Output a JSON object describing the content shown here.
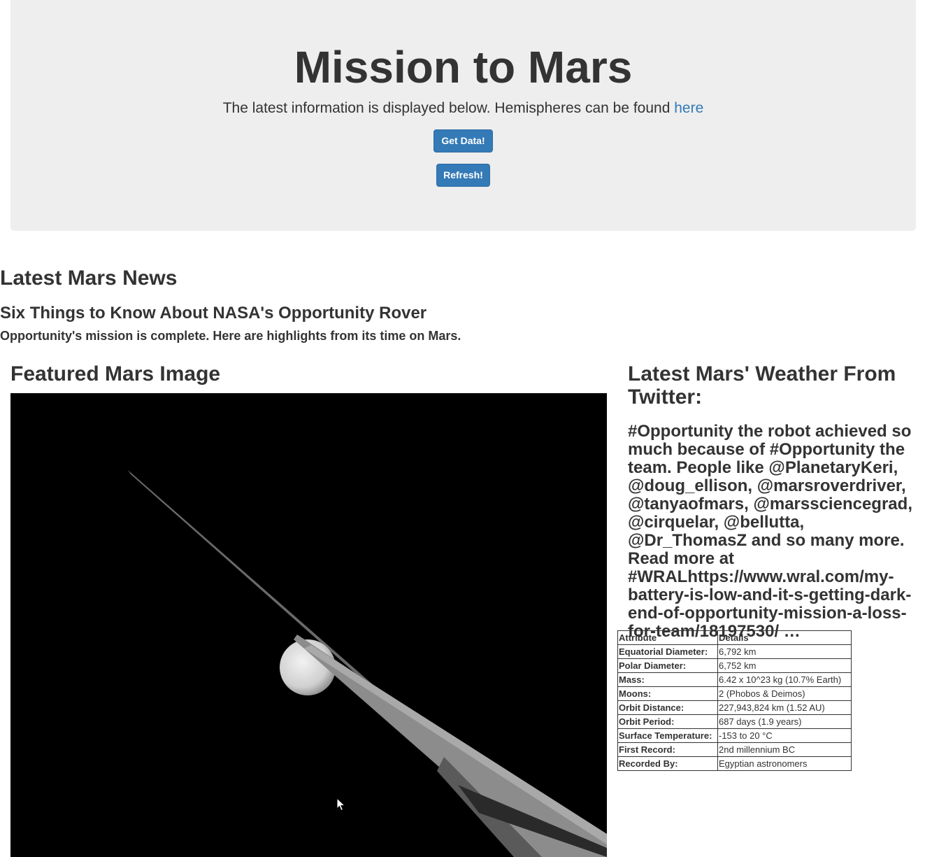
{
  "header": {
    "title": "Mission to Mars",
    "subtitle": "The latest information is displayed below. Hemispheres can be found",
    "hemispheres_link": "here",
    "get_data_label": "Get Data!",
    "refresh_label": "Refresh!"
  },
  "news": {
    "heading": "Latest Mars News",
    "title": "Six Things to Know About NASA's Opportunity Rover",
    "teaser": "Opportunity's mission is complete. Here are highlights from its time on Mars."
  },
  "featured": {
    "heading": "Featured Mars Image"
  },
  "weather": {
    "heading": "Latest Mars' Weather From Twitter:",
    "tweet": "#Opportunity the robot achieved so much because of #Opportunity the team. People like @PlanetaryKeri, @doug_ellison, @marsroverdriver, @tanyaofmars, @marssciencegrad, @cirquelar, @bellutta, @Dr_ThomasZ and so many more. Read more at #WRALhttps://www.wral.com/my-battery-is-low-and-it-s-getting-dark-end-of-opportunity-mission-a-loss-for-team/18197530/ …"
  },
  "facts": {
    "headers": [
      "Attribute",
      "Details"
    ],
    "rows": [
      [
        "Equatorial Diameter:",
        "6,792 km"
      ],
      [
        "Polar Diameter:",
        "6,752 km"
      ],
      [
        "Mass:",
        "6.42 x 10^23 kg (10.7% Earth)"
      ],
      [
        "Moons:",
        "2 (Phobos & Deimos)"
      ],
      [
        "Orbit Distance:",
        "227,943,824 km (1.52 AU)"
      ],
      [
        "Orbit Period:",
        "687 days (1.9 years)"
      ],
      [
        "Surface Temperature:",
        "-153 to 20 °C"
      ],
      [
        "First Record:",
        "2nd millennium BC"
      ],
      [
        "Recorded By:",
        "Egyptian astronomers"
      ]
    ]
  },
  "colors": {
    "jumbotron_bg": "#eeeeee",
    "button_bg": "#337ab7",
    "link": "#337ab7",
    "text": "#333333"
  }
}
